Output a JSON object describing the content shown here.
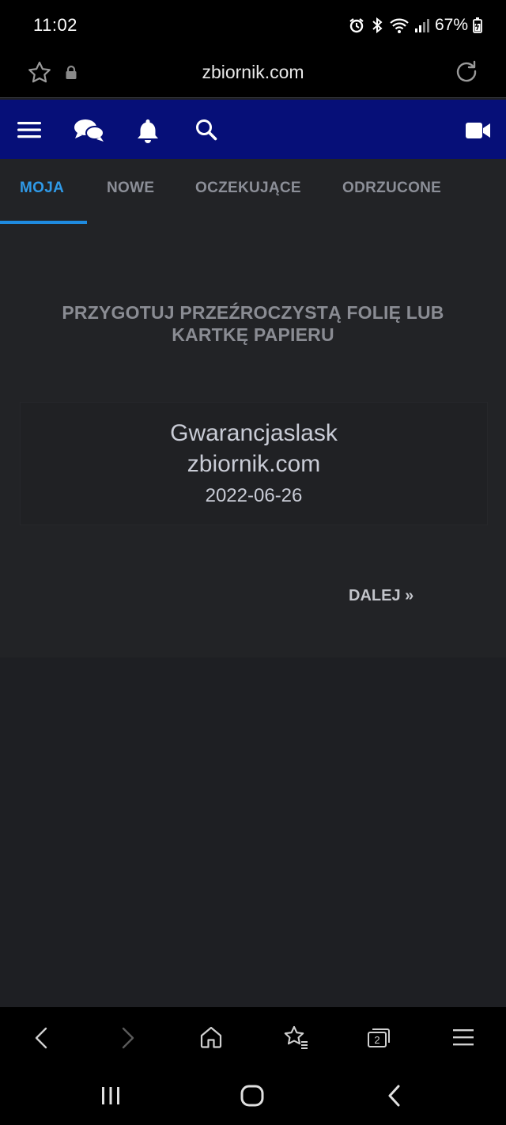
{
  "status_bar": {
    "time": "11:02",
    "battery": "67%",
    "icons": [
      "alarm-icon",
      "bluetooth-icon",
      "wifi-icon",
      "signal-icon",
      "battery-charging-icon"
    ]
  },
  "url_bar": {
    "url": "zbiornik.com",
    "icons": [
      "star-icon",
      "lock-icon",
      "reload-icon"
    ]
  },
  "site_nav": {
    "background": "#060f78",
    "icons": [
      "menu-icon",
      "chat-icon",
      "bell-icon",
      "search-icon",
      "video-camera-icon"
    ]
  },
  "tabs": [
    {
      "label": "MOJA",
      "active": true
    },
    {
      "label": "NOWE",
      "active": false
    },
    {
      "label": "OCZEKUJĄCE",
      "active": false
    },
    {
      "label": "ODRZUCONE",
      "active": false
    }
  ],
  "accent_color": "#2f9ae8",
  "main": {
    "instruction_line1": "PRZYGOTUJ PRZEŹROCZYSTĄ FOLIĘ LUB",
    "instruction_line2": "KARTKĘ PAPIERU",
    "card": {
      "title": "Gwarancjaslask",
      "site": "zbiornik.com",
      "date": "2022-06-26"
    },
    "next_label": "DALEJ »"
  },
  "browser_toolbar": {
    "tab_count": "2",
    "icons": [
      "back-icon",
      "forward-icon",
      "home-icon",
      "bookmarks-icon",
      "tabs-icon",
      "menu-icon"
    ]
  },
  "system_nav": {
    "icons": [
      "recent-apps-icon",
      "home-button-icon",
      "back-button-icon"
    ]
  }
}
